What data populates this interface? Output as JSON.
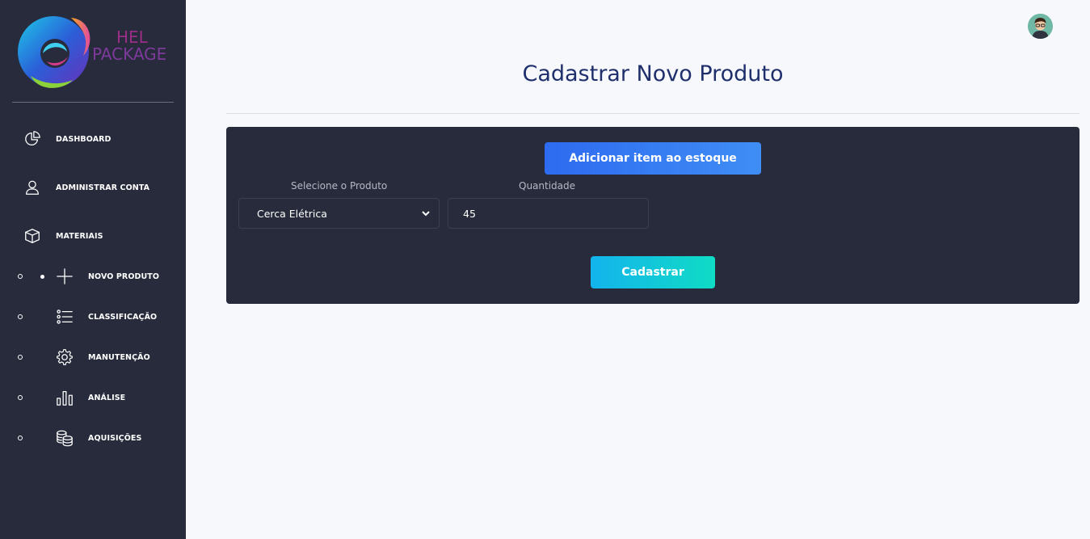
{
  "brand": {
    "line1": "HEL",
    "line2": "PACKAGE"
  },
  "sidebar": {
    "main_items": [
      {
        "label": "DASHBOARD",
        "icon": "pie-chart-icon"
      },
      {
        "label": "ADMINISTRAR CONTA",
        "icon": "user-icon"
      },
      {
        "label": "MATERIAIS",
        "icon": "box-icon"
      }
    ],
    "sub_items": [
      {
        "label": "NOVO PRODUTO",
        "icon": "plus-icon",
        "active": true
      },
      {
        "label": "CLASSIFICAÇÃO",
        "icon": "list-icon"
      },
      {
        "label": "MANUTENÇÃO",
        "icon": "gear-icon"
      },
      {
        "label": "ANÁLISE",
        "icon": "bar-chart-icon"
      },
      {
        "label": "AQUISIÇÕES",
        "icon": "coins-icon"
      }
    ]
  },
  "header": {
    "title": "Cadastrar Novo Produto",
    "avatar_icon": "avatar-icon"
  },
  "form": {
    "add_button": "Adicionar item ao estoque",
    "product_label": "Selecione o Produto",
    "product_value": "Cerca Elétrica",
    "quantity_label": "Quantidade",
    "quantity_value": "45",
    "submit_button": "Cadastrar"
  },
  "colors": {
    "sidebar_bg": "#272b3c",
    "page_bg": "#f6f8fc",
    "title": "#1f2f6b",
    "add_button": "#2e6bf0",
    "submit_button": "#10dcc5"
  }
}
